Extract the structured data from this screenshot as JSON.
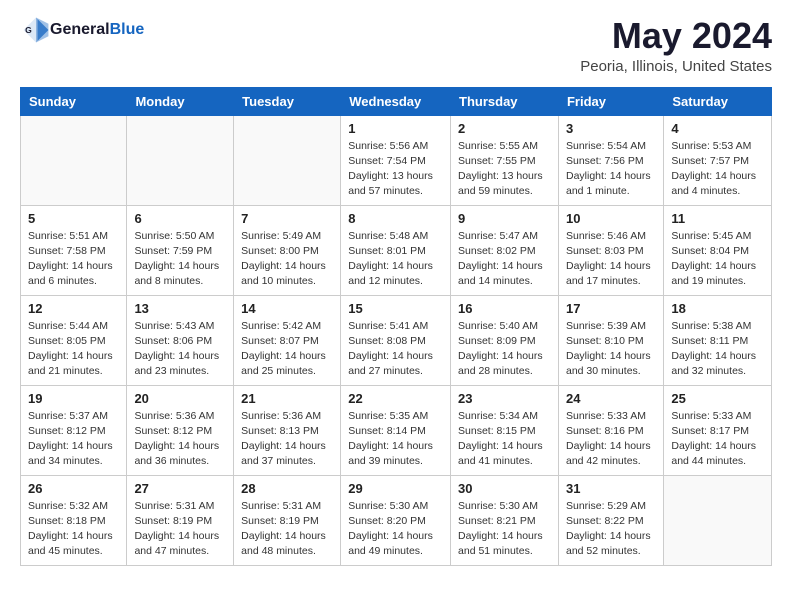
{
  "header": {
    "logo_general": "General",
    "logo_blue": "Blue",
    "month": "May 2024",
    "location": "Peoria, Illinois, United States"
  },
  "weekdays": [
    "Sunday",
    "Monday",
    "Tuesday",
    "Wednesday",
    "Thursday",
    "Friday",
    "Saturday"
  ],
  "weeks": [
    [
      {
        "day": "",
        "info": ""
      },
      {
        "day": "",
        "info": ""
      },
      {
        "day": "",
        "info": ""
      },
      {
        "day": "1",
        "info": "Sunrise: 5:56 AM\nSunset: 7:54 PM\nDaylight: 13 hours\nand 57 minutes."
      },
      {
        "day": "2",
        "info": "Sunrise: 5:55 AM\nSunset: 7:55 PM\nDaylight: 13 hours\nand 59 minutes."
      },
      {
        "day": "3",
        "info": "Sunrise: 5:54 AM\nSunset: 7:56 PM\nDaylight: 14 hours\nand 1 minute."
      },
      {
        "day": "4",
        "info": "Sunrise: 5:53 AM\nSunset: 7:57 PM\nDaylight: 14 hours\nand 4 minutes."
      }
    ],
    [
      {
        "day": "5",
        "info": "Sunrise: 5:51 AM\nSunset: 7:58 PM\nDaylight: 14 hours\nand 6 minutes."
      },
      {
        "day": "6",
        "info": "Sunrise: 5:50 AM\nSunset: 7:59 PM\nDaylight: 14 hours\nand 8 minutes."
      },
      {
        "day": "7",
        "info": "Sunrise: 5:49 AM\nSunset: 8:00 PM\nDaylight: 14 hours\nand 10 minutes."
      },
      {
        "day": "8",
        "info": "Sunrise: 5:48 AM\nSunset: 8:01 PM\nDaylight: 14 hours\nand 12 minutes."
      },
      {
        "day": "9",
        "info": "Sunrise: 5:47 AM\nSunset: 8:02 PM\nDaylight: 14 hours\nand 14 minutes."
      },
      {
        "day": "10",
        "info": "Sunrise: 5:46 AM\nSunset: 8:03 PM\nDaylight: 14 hours\nand 17 minutes."
      },
      {
        "day": "11",
        "info": "Sunrise: 5:45 AM\nSunset: 8:04 PM\nDaylight: 14 hours\nand 19 minutes."
      }
    ],
    [
      {
        "day": "12",
        "info": "Sunrise: 5:44 AM\nSunset: 8:05 PM\nDaylight: 14 hours\nand 21 minutes."
      },
      {
        "day": "13",
        "info": "Sunrise: 5:43 AM\nSunset: 8:06 PM\nDaylight: 14 hours\nand 23 minutes."
      },
      {
        "day": "14",
        "info": "Sunrise: 5:42 AM\nSunset: 8:07 PM\nDaylight: 14 hours\nand 25 minutes."
      },
      {
        "day": "15",
        "info": "Sunrise: 5:41 AM\nSunset: 8:08 PM\nDaylight: 14 hours\nand 27 minutes."
      },
      {
        "day": "16",
        "info": "Sunrise: 5:40 AM\nSunset: 8:09 PM\nDaylight: 14 hours\nand 28 minutes."
      },
      {
        "day": "17",
        "info": "Sunrise: 5:39 AM\nSunset: 8:10 PM\nDaylight: 14 hours\nand 30 minutes."
      },
      {
        "day": "18",
        "info": "Sunrise: 5:38 AM\nSunset: 8:11 PM\nDaylight: 14 hours\nand 32 minutes."
      }
    ],
    [
      {
        "day": "19",
        "info": "Sunrise: 5:37 AM\nSunset: 8:12 PM\nDaylight: 14 hours\nand 34 minutes."
      },
      {
        "day": "20",
        "info": "Sunrise: 5:36 AM\nSunset: 8:12 PM\nDaylight: 14 hours\nand 36 minutes."
      },
      {
        "day": "21",
        "info": "Sunrise: 5:36 AM\nSunset: 8:13 PM\nDaylight: 14 hours\nand 37 minutes."
      },
      {
        "day": "22",
        "info": "Sunrise: 5:35 AM\nSunset: 8:14 PM\nDaylight: 14 hours\nand 39 minutes."
      },
      {
        "day": "23",
        "info": "Sunrise: 5:34 AM\nSunset: 8:15 PM\nDaylight: 14 hours\nand 41 minutes."
      },
      {
        "day": "24",
        "info": "Sunrise: 5:33 AM\nSunset: 8:16 PM\nDaylight: 14 hours\nand 42 minutes."
      },
      {
        "day": "25",
        "info": "Sunrise: 5:33 AM\nSunset: 8:17 PM\nDaylight: 14 hours\nand 44 minutes."
      }
    ],
    [
      {
        "day": "26",
        "info": "Sunrise: 5:32 AM\nSunset: 8:18 PM\nDaylight: 14 hours\nand 45 minutes."
      },
      {
        "day": "27",
        "info": "Sunrise: 5:31 AM\nSunset: 8:19 PM\nDaylight: 14 hours\nand 47 minutes."
      },
      {
        "day": "28",
        "info": "Sunrise: 5:31 AM\nSunset: 8:19 PM\nDaylight: 14 hours\nand 48 minutes."
      },
      {
        "day": "29",
        "info": "Sunrise: 5:30 AM\nSunset: 8:20 PM\nDaylight: 14 hours\nand 49 minutes."
      },
      {
        "day": "30",
        "info": "Sunrise: 5:30 AM\nSunset: 8:21 PM\nDaylight: 14 hours\nand 51 minutes."
      },
      {
        "day": "31",
        "info": "Sunrise: 5:29 AM\nSunset: 8:22 PM\nDaylight: 14 hours\nand 52 minutes."
      },
      {
        "day": "",
        "info": ""
      }
    ]
  ]
}
